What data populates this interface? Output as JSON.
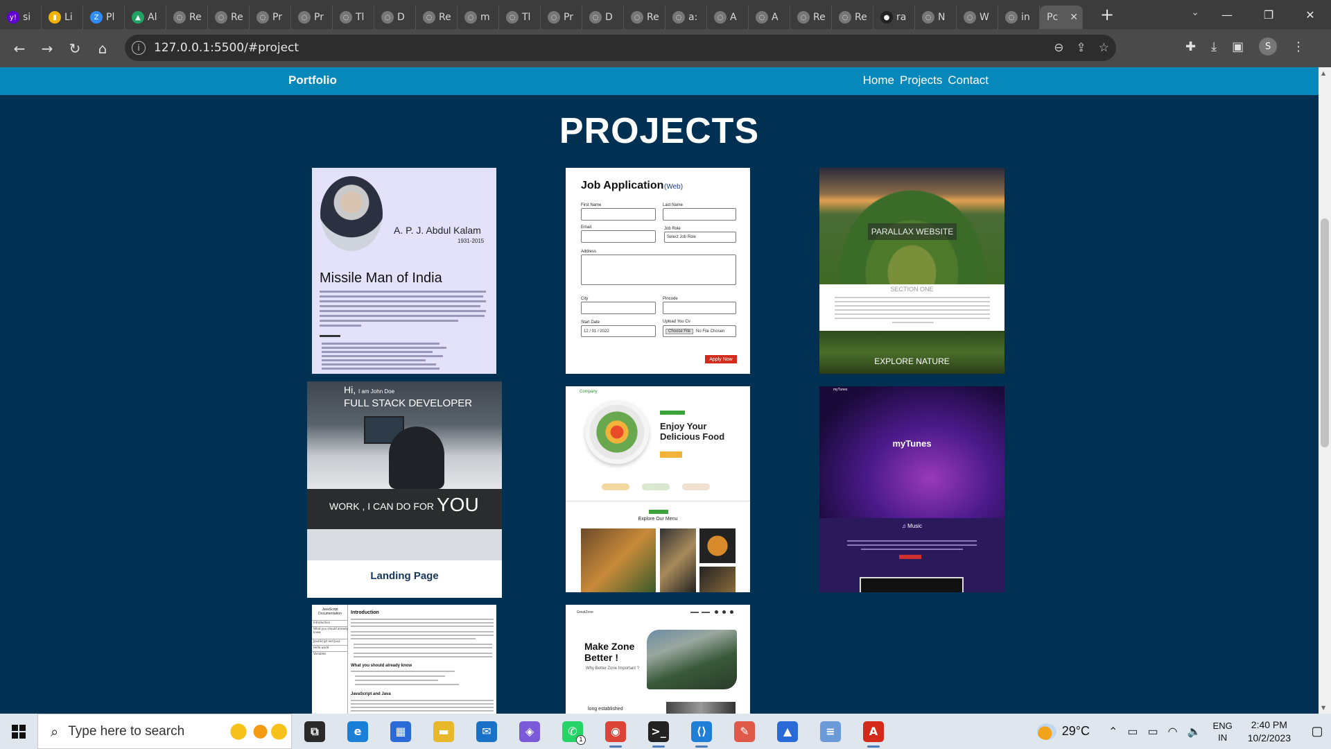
{
  "browser": {
    "tabs": [
      {
        "fav": "y!",
        "label": "si",
        "favColor": "#6001d2"
      },
      {
        "fav": "▮",
        "label": "Li",
        "favColor": "#f1b300"
      },
      {
        "fav": "Z",
        "label": "Pl",
        "favColor": "#2d8cff"
      },
      {
        "fav": "▲",
        "label": "Al",
        "favColor": "#1fa463"
      },
      {
        "fav": "◌",
        "label": "Re",
        "favColor": "#777777"
      },
      {
        "fav": "◌",
        "label": "Re",
        "favColor": "#777777"
      },
      {
        "fav": "◌",
        "label": "Pr",
        "favColor": "#777777"
      },
      {
        "fav": "◌",
        "label": "Pr",
        "favColor": "#777777"
      },
      {
        "fav": "◌",
        "label": "Tl",
        "favColor": "#777777"
      },
      {
        "fav": "◌",
        "label": "D",
        "favColor": "#777777"
      },
      {
        "fav": "◌",
        "label": "Re",
        "favColor": "#777777"
      },
      {
        "fav": "◌",
        "label": "m",
        "favColor": "#777777"
      },
      {
        "fav": "◌",
        "label": "Tl",
        "favColor": "#777777"
      },
      {
        "fav": "◌",
        "label": "Pr",
        "favColor": "#777777"
      },
      {
        "fav": "◌",
        "label": "D",
        "favColor": "#777777"
      },
      {
        "fav": "◌",
        "label": "Re",
        "favColor": "#777777"
      },
      {
        "fav": "◌",
        "label": "a:",
        "favColor": "#777777"
      },
      {
        "fav": "◌",
        "label": "A",
        "favColor": "#777777"
      },
      {
        "fav": "◌",
        "label": "A",
        "favColor": "#777777"
      },
      {
        "fav": "◌",
        "label": "Re",
        "favColor": "#777777"
      },
      {
        "fav": "◌",
        "label": "Re",
        "favColor": "#777777"
      },
      {
        "fav": "●",
        "label": "ra",
        "favColor": "#222222"
      },
      {
        "fav": "◌",
        "label": "N",
        "favColor": "#777777"
      },
      {
        "fav": "◌",
        "label": "W",
        "favColor": "#777777"
      },
      {
        "fav": "◌",
        "label": "in",
        "favColor": "#777777"
      }
    ],
    "active_tab": {
      "label": "Pc",
      "close": "✕"
    },
    "new_tab": "+",
    "tab_list": "⌄",
    "window_controls": {
      "minimize": "—",
      "restore": "❐",
      "close": "✕"
    },
    "nav": {
      "back": "←",
      "forward": "→",
      "reload": "↻",
      "home": "⌂"
    },
    "url": "127.0.0.1:5500/#project",
    "info_icon": "i",
    "omni_icons": {
      "zoom": "⊖",
      "share": "⇪",
      "bookmark": "☆"
    },
    "toolbar_icons": {
      "extensions": "✚",
      "downloads": "⤓",
      "sidepanel": "▣",
      "menu": "⋮"
    },
    "profile": "S"
  },
  "site": {
    "brand": "Portfolio",
    "nav": [
      "Home",
      "Projects",
      "Contact"
    ],
    "heading": "PROJECTS"
  },
  "projects": {
    "kalam": {
      "name": "A. P. J. Abdul Kalam",
      "years": "1931-2015",
      "title": "Missile Man of India"
    },
    "job": {
      "title": "Job Application",
      "tag": "(Web)",
      "labels": {
        "first": "First Name",
        "last": "Last Name",
        "email": "Email",
        "role": "Job Role",
        "address": "Address",
        "city": "City",
        "pincode": "Pincode",
        "date": "Start Date",
        "upload": "Upload You Cv"
      },
      "role_placeholder": "Select Job Role",
      "date_value": "12 / 01 / 2022",
      "file_btn": "Choose File",
      "file_status": "No File Chosen",
      "apply": "Apply Now"
    },
    "parallax": {
      "title": "PARALLAX WEBSITE",
      "section": "SECTION ONE",
      "explore": "EXPLORE NATURE"
    },
    "landing": {
      "hi": "Hi,",
      "name": "I am John Doe",
      "role": "FULL STACK DEVELOPER",
      "work": "WORK , I CAN DO FOR",
      "you": "YOU",
      "label": "Landing Page"
    },
    "food": {
      "logo": "Company",
      "title": "Enjoy Your Delicious Food",
      "menu": "Explore Our Menu"
    },
    "tunes": {
      "brand": "myTunes",
      "title": "myTunes",
      "music": "♫ Music"
    },
    "docs": {
      "side_title": "JavaScript Documentation",
      "side_items": [
        "Introduction",
        "What you should already know",
        "JavaScript and Java",
        "Hello world",
        "Variables"
      ],
      "intro": "Introduction",
      "know": "What you should already know",
      "java": "JavaScript and Java"
    },
    "zone": {
      "logo": "GreatZone",
      "title": "Make Zone Better !",
      "sub": "Why Better Zone Important ?",
      "long": "long established"
    }
  },
  "taskbar": {
    "search_placeholder": "Type here to search",
    "apps": [
      {
        "name": "task-view",
        "glyph": "⧉",
        "color": "#2a2a2a",
        "running": false
      },
      {
        "name": "edge",
        "glyph": "e",
        "color": "#1a7fd6",
        "running": false
      },
      {
        "name": "store",
        "glyph": "▦",
        "color": "#2a6ad8",
        "running": false
      },
      {
        "name": "file-explorer",
        "glyph": "▬",
        "color": "#e8b82a",
        "running": false
      },
      {
        "name": "mail",
        "glyph": "✉",
        "color": "#1a72c8",
        "running": false
      },
      {
        "name": "copilot",
        "glyph": "◈",
        "color": "#7a5ad8",
        "running": false
      },
      {
        "name": "whatsapp",
        "glyph": "✆",
        "color": "#25d366",
        "running": false
      },
      {
        "name": "chrome",
        "glyph": "◉",
        "color": "#db4437",
        "running": true
      },
      {
        "name": "terminal",
        "glyph": ">_",
        "color": "#222222",
        "running": true
      },
      {
        "name": "vscode",
        "glyph": "⟨⟩",
        "color": "#1f7ed6",
        "running": true
      },
      {
        "name": "paint",
        "glyph": "✎",
        "color": "#e05a4a",
        "running": false
      },
      {
        "name": "photos",
        "glyph": "▲",
        "color": "#2a6ad8",
        "running": false
      },
      {
        "name": "notepad",
        "glyph": "≡",
        "color": "#6a9ad8",
        "running": false
      },
      {
        "name": "acrobat",
        "glyph": "A",
        "color": "#d42a1a",
        "running": true
      }
    ],
    "whatsapp_badge": "1",
    "weather": "29°C",
    "tray_icons": {
      "chevron": "⌃",
      "meet": "▭",
      "battery": "▭",
      "wifi": "◠",
      "volume": "🔈"
    },
    "lang": [
      "ENG",
      "IN"
    ],
    "time": "2:40 PM",
    "date": "10/2/2023",
    "notification": "▢"
  },
  "colors": {
    "nav_bg": "#0788bb",
    "page_bg": "#003152",
    "apply_btn": "#d42a1a"
  }
}
